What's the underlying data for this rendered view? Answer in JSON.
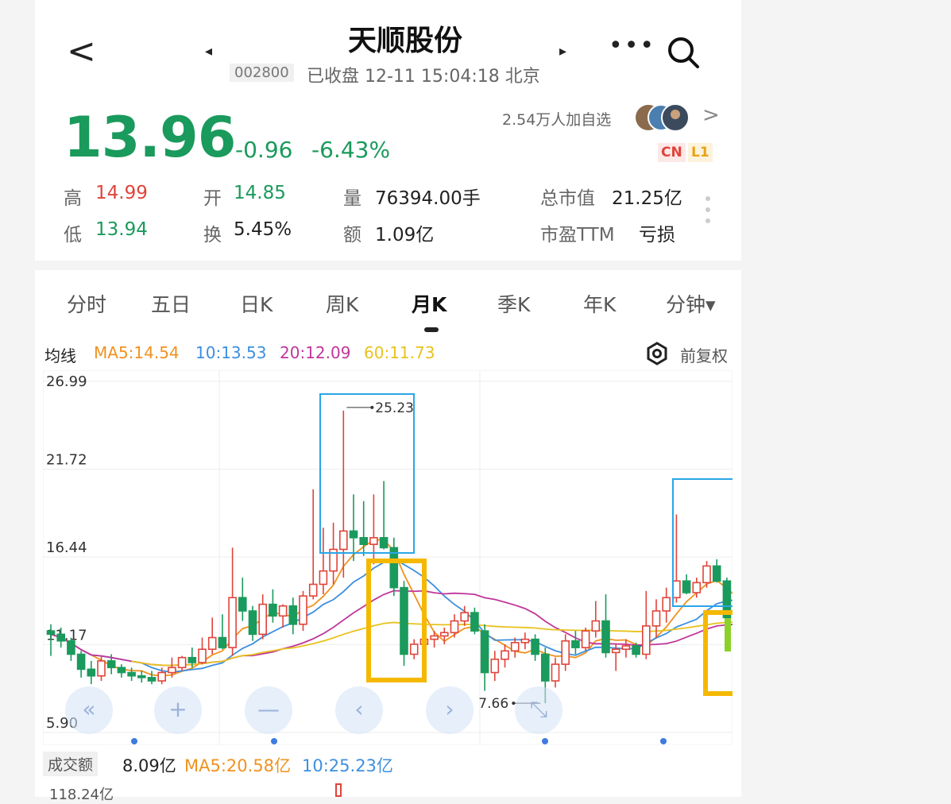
{
  "header": {
    "back_label": "<",
    "title": "天顺股份",
    "prev_label": "◂",
    "next_label": "▸",
    "code": "002800",
    "status": "已收盘 12-11 15:04:18 北京",
    "more_label": "•••"
  },
  "quote": {
    "price": "13.96",
    "change": "-0.96",
    "change_pct": "-6.43%",
    "followers": "2.54万人加自选",
    "followers_chevron": ">",
    "badge_cn": "CN",
    "badge_l1": "L1",
    "stats": [
      {
        "label": "高",
        "value": "14.99"
      },
      {
        "label": "开",
        "value": "14.85"
      },
      {
        "label": "量",
        "value": "76394.00手"
      },
      {
        "label": "总市值",
        "value": "21.25亿"
      },
      {
        "label": "低",
        "value": "13.94"
      },
      {
        "label": "换",
        "value": "5.45%"
      },
      {
        "label": "额",
        "value": "1.09亿"
      },
      {
        "label": "市盈TTM",
        "value": "亏损"
      }
    ]
  },
  "tabs": [
    "分时",
    "五日",
    "日K",
    "周K",
    "月K",
    "季K",
    "年K",
    "分钟▾"
  ],
  "active_tab": "月K",
  "ma": {
    "label": "均线",
    "ma5": "MA5:14.54",
    "ma10": "10:13.53",
    "ma20": "20:12.09",
    "ma60": "60:11.73",
    "restore": "前复权",
    "colors": {
      "ma5": "#f0921e",
      "ma10": "#3d8fe0",
      "ma20": "#c0369a",
      "ma60": "#e8c21e"
    }
  },
  "chart_data": {
    "type": "candlestick",
    "y_ticks": [
      "26.99",
      "21.72",
      "16.44",
      "11.17",
      "5.90"
    ],
    "ylim": [
      5.9,
      26.99
    ],
    "annotations": {
      "high": "25.23",
      "low": "7.66"
    },
    "candles": [
      [
        12.0,
        12.4,
        10.5,
        11.8
      ],
      [
        11.8,
        12.2,
        11.0,
        11.4
      ],
      [
        11.4,
        11.6,
        10.2,
        10.6
      ],
      [
        10.6,
        10.8,
        9.2,
        9.7
      ],
      [
        9.7,
        10.2,
        8.8,
        9.3
      ],
      [
        9.3,
        10.5,
        9.0,
        10.2
      ],
      [
        10.2,
        10.6,
        9.4,
        9.8
      ],
      [
        9.8,
        10.0,
        9.2,
        9.5
      ],
      [
        9.5,
        9.8,
        9.0,
        9.3
      ],
      [
        9.3,
        9.6,
        8.9,
        9.2
      ],
      [
        9.2,
        9.6,
        8.8,
        9.0
      ],
      [
        9.0,
        9.8,
        8.8,
        9.5
      ],
      [
        9.5,
        10.4,
        9.2,
        9.8
      ],
      [
        9.8,
        10.5,
        9.6,
        10.4
      ],
      [
        10.4,
        11.0,
        9.8,
        10.1
      ],
      [
        10.1,
        11.6,
        10.0,
        10.9
      ],
      [
        10.9,
        12.8,
        10.6,
        11.6
      ],
      [
        11.6,
        13.0,
        10.9,
        11.0
      ],
      [
        11.0,
        17.0,
        10.5,
        14.0
      ],
      [
        14.0,
        15.2,
        12.6,
        13.2
      ],
      [
        13.2,
        13.5,
        11.4,
        11.8
      ],
      [
        11.8,
        14.2,
        11.5,
        13.6
      ],
      [
        13.6,
        14.5,
        12.5,
        12.9
      ],
      [
        12.9,
        13.6,
        12.2,
        13.5
      ],
      [
        13.5,
        14.0,
        11.8,
        12.4
      ],
      [
        12.4,
        14.4,
        12.0,
        14.1
      ],
      [
        14.1,
        20.5,
        13.9,
        14.8
      ],
      [
        14.8,
        18.2,
        14.2,
        15.6
      ],
      [
        15.6,
        18.5,
        14.8,
        16.9
      ],
      [
        16.9,
        25.23,
        15.2,
        18.0
      ],
      [
        18.0,
        20.2,
        16.2,
        17.6
      ],
      [
        17.6,
        19.8,
        16.5,
        17.2
      ],
      [
        17.2,
        20.2,
        16.0,
        17.6
      ],
      [
        17.6,
        21.0,
        16.9,
        17.0
      ],
      [
        17.0,
        17.6,
        14.1,
        14.6
      ],
      [
        14.6,
        15.0,
        9.9,
        10.6
      ],
      [
        10.6,
        11.5,
        10.3,
        11.2
      ],
      [
        11.2,
        11.8,
        10.8,
        11.5
      ],
      [
        11.5,
        12.0,
        11.0,
        11.7
      ],
      [
        11.7,
        12.2,
        11.2,
        11.9
      ],
      [
        11.9,
        13.0,
        11.6,
        12.6
      ],
      [
        12.6,
        13.5,
        12.3,
        13.1
      ],
      [
        13.1,
        13.4,
        11.8,
        12.0
      ],
      [
        12.0,
        12.4,
        8.4,
        9.5
      ],
      [
        9.5,
        10.8,
        9.0,
        10.3
      ],
      [
        10.3,
        11.2,
        9.8,
        10.8
      ],
      [
        10.8,
        11.6,
        10.4,
        11.3
      ],
      [
        11.3,
        11.9,
        10.9,
        11.5
      ],
      [
        11.5,
        11.8,
        10.2,
        10.6
      ],
      [
        10.6,
        11.0,
        7.66,
        9.0
      ],
      [
        9.0,
        10.4,
        8.6,
        10.0
      ],
      [
        10.0,
        11.8,
        9.6,
        11.4
      ],
      [
        11.4,
        12.0,
        10.6,
        11.0
      ],
      [
        11.0,
        12.2,
        10.8,
        12.0
      ],
      [
        12.0,
        13.8,
        11.6,
        12.6
      ],
      [
        12.6,
        14.2,
        10.4,
        10.7
      ],
      [
        10.7,
        11.2,
        9.6,
        10.9
      ],
      [
        10.9,
        11.5,
        10.4,
        11.1
      ],
      [
        11.1,
        11.3,
        10.4,
        10.6
      ],
      [
        10.6,
        14.4,
        10.3,
        12.3
      ],
      [
        12.3,
        13.9,
        11.6,
        13.2
      ],
      [
        13.2,
        14.6,
        12.5,
        14.0
      ],
      [
        14.0,
        19.0,
        13.7,
        15.0
      ],
      [
        15.0,
        15.4,
        14.2,
        14.3
      ],
      [
        14.3,
        15.2,
        14.0,
        14.9
      ],
      [
        14.9,
        16.2,
        14.6,
        15.9
      ],
      [
        15.9,
        16.3,
        14.9,
        15.0
      ],
      [
        15.0,
        15.2,
        12.2,
        12.8
      ],
      [
        12.8,
        13.2,
        11.0,
        11.4
      ]
    ],
    "volume": {
      "label": "成交额",
      "value": "8.09亿",
      "ma5": "MA5:20.58亿",
      "ma10": "10:25.23亿",
      "max_tick": "118.24亿"
    }
  },
  "controls": [
    "«",
    "+",
    "—",
    "‹",
    "›",
    "⤡"
  ]
}
